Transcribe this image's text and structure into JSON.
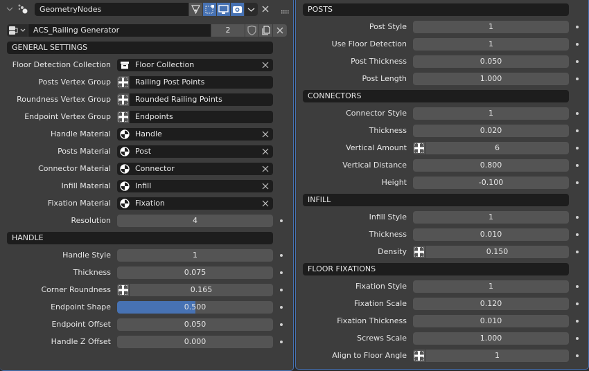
{
  "modifier": {
    "name": "GeometryNodes",
    "icons": [
      "collapse-chevron-icon",
      "geometry-nodes-icon",
      "edit-mode-toggle-icon",
      "cage-toggle-icon",
      "realtime-display-icon",
      "render-camera-icon",
      "dropdown-chevron-icon",
      "close-icon",
      "drag-handle-icon"
    ],
    "node_group": "ACS_Railing Generator",
    "users": "2",
    "fake_user_icon": "shield-icon",
    "duplicate_icon": "duplicate-icon",
    "unlink_icon": "close-icon"
  },
  "left": {
    "sections": [
      {
        "title": "GENERAL SETTINGS",
        "fields": [
          {
            "label": "Floor Detection Collection",
            "kind": "collection",
            "value": "Floor Collection",
            "clear": true
          },
          {
            "label": "Posts Vertex Group",
            "kind": "vgroup",
            "value": "Railing Post Points"
          },
          {
            "label": "Roundness Vertex Group",
            "kind": "vgroup",
            "value": "Rounded Railing Points"
          },
          {
            "label": "Endpoint Vertex Group",
            "kind": "vgroup",
            "value": "Endpoints"
          },
          {
            "label": "Handle Material",
            "kind": "material",
            "value": "Handle",
            "clear": true
          },
          {
            "label": "Posts Material",
            "kind": "material",
            "value": "Post",
            "clear": true
          },
          {
            "label": "Connector Material",
            "kind": "material",
            "value": "Connector",
            "clear": true
          },
          {
            "label": "Infill Material",
            "kind": "material",
            "value": "Infill",
            "clear": true
          },
          {
            "label": "Fixation Material",
            "kind": "material",
            "value": "Fixation",
            "clear": true
          },
          {
            "label": "Resolution",
            "kind": "number",
            "value": "4"
          }
        ]
      },
      {
        "title": "HANDLE",
        "fields": [
          {
            "label": "Handle Style",
            "kind": "number",
            "value": "1"
          },
          {
            "label": "Thickness",
            "kind": "number",
            "value": "0.075"
          },
          {
            "label": "Corner Roundness",
            "kind": "number",
            "value": "0.165",
            "attribute_toggle": true
          },
          {
            "label": "Endpoint Shape",
            "kind": "slider",
            "value": "0.500",
            "fraction": 0.5
          },
          {
            "label": "Endpoint Offset",
            "kind": "number",
            "value": "0.050"
          },
          {
            "label": "Handle Z Offset",
            "kind": "number",
            "value": "0.000"
          }
        ]
      }
    ]
  },
  "right": {
    "sections": [
      {
        "title": "POSTS",
        "fields": [
          {
            "label": "Post Style",
            "kind": "number",
            "value": "1"
          },
          {
            "label": "Use Floor Detection",
            "kind": "number",
            "value": "1"
          },
          {
            "label": "Post Thickness",
            "kind": "number",
            "value": "0.050"
          },
          {
            "label": "Post Length",
            "kind": "number",
            "value": "1.000"
          }
        ]
      },
      {
        "title": "CONNECTORS",
        "fields": [
          {
            "label": "Connector Style",
            "kind": "number",
            "value": "1"
          },
          {
            "label": "Thickness",
            "kind": "number",
            "value": "0.020"
          },
          {
            "label": "Vertical Amount",
            "kind": "number",
            "value": "6",
            "attribute_toggle": true
          },
          {
            "label": "Vertical Distance",
            "kind": "number",
            "value": "0.800"
          },
          {
            "label": "Height",
            "kind": "number",
            "value": "-0.100"
          }
        ]
      },
      {
        "title": "INFILL",
        "fields": [
          {
            "label": "Infill Style",
            "kind": "number",
            "value": "1"
          },
          {
            "label": "Thickness",
            "kind": "number",
            "value": "0.010"
          },
          {
            "label": "Density",
            "kind": "number",
            "value": "0.150",
            "attribute_toggle": true
          }
        ]
      },
      {
        "title": "FLOOR FIXATIONS",
        "fields": [
          {
            "label": "Fixation Style",
            "kind": "number",
            "value": "1"
          },
          {
            "label": "Fixation Scale",
            "kind": "number",
            "value": "0.120"
          },
          {
            "label": "Fixation Thickness",
            "kind": "number",
            "value": "0.010"
          },
          {
            "label": "Screws Scale",
            "kind": "number",
            "value": "1.000"
          },
          {
            "label": "Align to Floor Angle",
            "kind": "number",
            "value": "1",
            "attribute_toggle": true
          }
        ]
      }
    ]
  },
  "colors": {
    "accent": "#4772b3",
    "panel": "#3d3d3d",
    "field": "#545454",
    "header": "#1d1d1d"
  }
}
